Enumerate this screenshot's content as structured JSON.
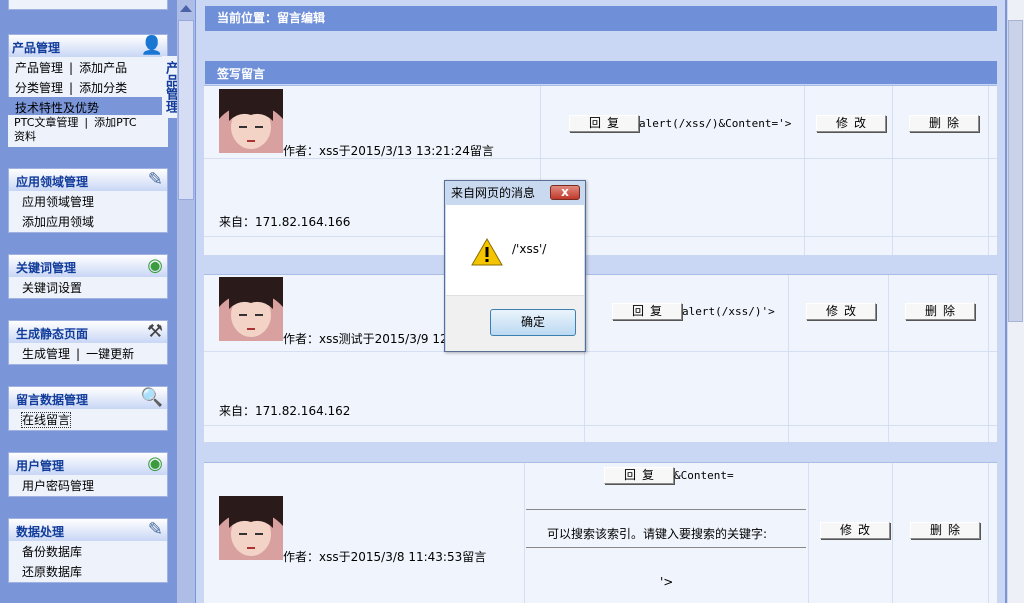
{
  "sidebar": {
    "product_panel": {
      "title": "产品管理",
      "rows": [
        {
          "a": "产品管理",
          "b": "添加产品"
        },
        {
          "a": "分类管理",
          "b": "添加分类"
        }
      ],
      "highlight": "技术特性及优势",
      "ptc_a": "PTC文章管理",
      "ptc_b": "添加PTC",
      "ptc_c": "资料",
      "tab_text": "产品管理"
    },
    "panels": [
      {
        "title": "应用领域管理",
        "items": [
          "应用领域管理",
          "添加应用领域"
        ],
        "icon": "edit-icon"
      },
      {
        "title": "关键词管理",
        "items": [
          "关键词设置"
        ],
        "icon": "globe-icon"
      },
      {
        "title": "生成静态页面",
        "items": [
          "生成管理",
          "一键更新"
        ],
        "icon": "tools-icon"
      },
      {
        "title": "留言数据管理",
        "items": [
          "在线留言"
        ],
        "icon": "magnifier-icon"
      },
      {
        "title": "用户管理",
        "items": [
          "用户密码管理"
        ],
        "icon": "globe-icon"
      },
      {
        "title": "数据处理",
        "items": [
          "备份数据库",
          "还原数据库"
        ],
        "icon": "edit-icon"
      }
    ]
  },
  "main": {
    "location": "当前位置：留言编辑",
    "section_title": "签写留言",
    "reply_label": "回复",
    "edit_label": "修改",
    "delete_label": "删除",
    "messages": [
      {
        "author": "作者：xss于2015/3/13 13:21:24留言",
        "content": "alert(/xss/)&Content='>",
        "from": "来自：171.82.164.166"
      },
      {
        "author": "作者：xss测试于2015/3/9 12:",
        "content": "alert(/xss/)'>",
        "from": "来自：171.82.164.162"
      },
      {
        "author": "作者：xss于2015/3/8 11:43:53留言",
        "content": "&Content=",
        "search_text": "可以搜索该索引。请键入要搜索的关键字:",
        "tail": "'>"
      }
    ]
  },
  "dialog": {
    "title": "来自网页的消息",
    "close": "x",
    "message": "/'xss'/",
    "ok": "确定",
    "icon": "warning-icon"
  }
}
